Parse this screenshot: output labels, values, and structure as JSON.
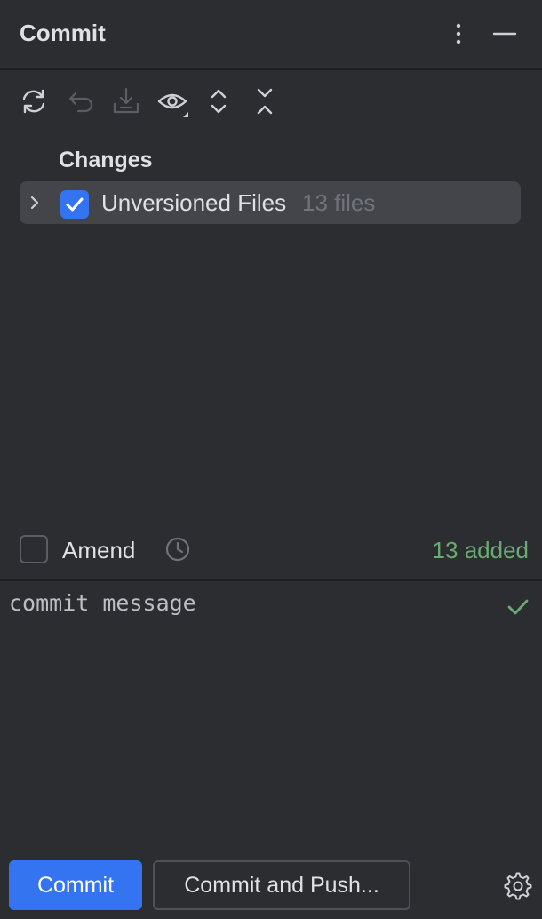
{
  "header": {
    "title": "Commit",
    "more_icon": "more-vertical-icon",
    "minimize_icon": "minimize-icon"
  },
  "toolbar": {
    "icons": [
      "refresh-icon",
      "rollback-icon",
      "shelve-icon",
      "view-options-icon",
      "expand-all-icon",
      "collapse-all-icon"
    ]
  },
  "changes": {
    "group_label": "Changes",
    "rows": [
      {
        "name": "Unversioned Files",
        "count": "13 files",
        "checked": true
      }
    ]
  },
  "amend": {
    "label": "Amend",
    "checked": false,
    "history_icon": "history-clock-icon",
    "summary": "13 added"
  },
  "message": {
    "text": "commit message",
    "status_icon": "check-icon"
  },
  "actions": {
    "commit_label": "Commit",
    "commit_push_label": "Commit and Push...",
    "settings_icon": "gear-icon"
  },
  "colors": {
    "background": "#2b2d30",
    "accent": "#3574f0",
    "success": "#6aab73",
    "muted": "#6f737a"
  }
}
